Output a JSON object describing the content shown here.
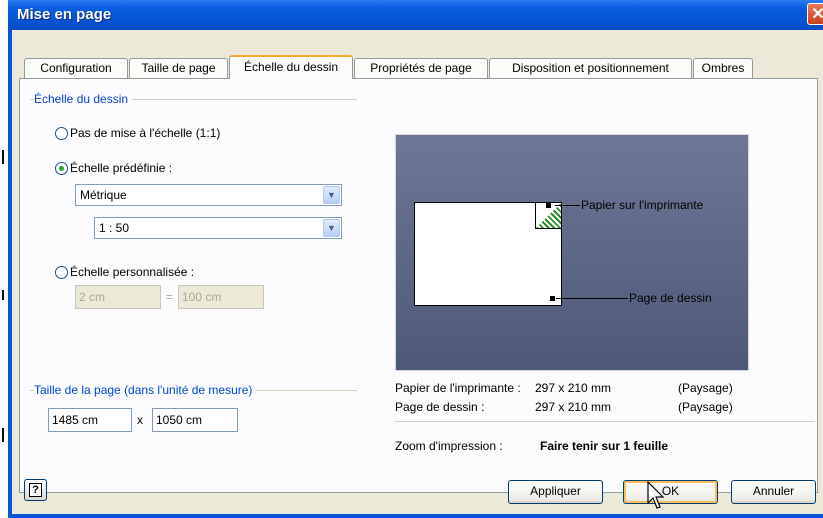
{
  "window": {
    "title": "Mise en page",
    "close_glyph": "✕"
  },
  "tabs": [
    {
      "label": "Configuration",
      "active": false
    },
    {
      "label": "Taille de page",
      "active": false
    },
    {
      "label": "Échelle du dessin",
      "active": true
    },
    {
      "label": "Propriétés de page",
      "active": false
    },
    {
      "label": "Disposition et positionnement",
      "active": false
    },
    {
      "label": "Ombres",
      "active": false
    }
  ],
  "scale_group": {
    "label": "Échelle du dessin",
    "options": [
      {
        "label": "Pas de mise à l'échelle (1:1)",
        "selected": false
      },
      {
        "label": "Échelle prédéfinie :",
        "selected": true
      },
      {
        "label": "Échelle personnalisée :",
        "selected": false
      }
    ],
    "preset_system": "Métrique",
    "preset_ratio": "1 : 50",
    "custom_left": "2 cm",
    "custom_equals": "=",
    "custom_right": "100 cm"
  },
  "page_size_group": {
    "label": "Taille de la page (dans l'unité de mesure)",
    "width": "1485 cm",
    "times": "x",
    "height": "1050 cm"
  },
  "preview": {
    "printer_paper_callout": "Papier sur l'imprimante",
    "drawing_page_callout": "Page de dessin"
  },
  "info": {
    "printer_paper_label": "Papier de l'imprimante :",
    "printer_paper_size": "297 x 210 mm",
    "printer_paper_orientation": "(Paysage)",
    "drawing_page_label": "Page de dessin :",
    "drawing_page_size": "297 x 210 mm",
    "drawing_page_orientation": "(Paysage)",
    "zoom_label": "Zoom d'impression :",
    "zoom_value": "Faire tenir sur 1 feuille"
  },
  "buttons": {
    "help_glyph": "?",
    "apply": "Appliquer",
    "ok": "OK",
    "cancel": "Annuler"
  },
  "colors": {
    "title_bar": "#0a5fe0",
    "group_label": "#0046d5",
    "active_tab_accent": "#f7a831",
    "preview_background": "#5e6787"
  }
}
